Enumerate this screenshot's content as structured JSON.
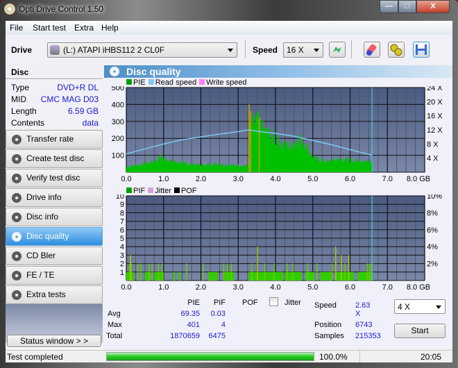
{
  "window": {
    "title": "Opti Drive Control 1.50"
  },
  "menu": [
    "File",
    "Start test",
    "Extra",
    "Help"
  ],
  "toolbar": {
    "drive_label": "Drive",
    "drive_value": "(L:)  ATAPI iHBS112   2 CL0F",
    "speed_label": "Speed",
    "speed_value": "16 X",
    "icons": [
      "refresh-icon",
      "eraser-icon",
      "settings-icon",
      "save-icon"
    ]
  },
  "disc": {
    "header": "Disc",
    "rows": [
      {
        "label": "Type",
        "value": "DVD+R DL"
      },
      {
        "label": "MID",
        "value": "CMC MAG D03"
      },
      {
        "label": "Length",
        "value": "6.59 GB"
      },
      {
        "label": "Contents",
        "value": "data"
      }
    ]
  },
  "nav": [
    {
      "label": "Transfer rate",
      "active": false
    },
    {
      "label": "Create test disc",
      "active": false
    },
    {
      "label": "Verify test disc",
      "active": false
    },
    {
      "label": "Drive info",
      "active": false
    },
    {
      "label": "Disc info",
      "active": false
    },
    {
      "label": "Disc quality",
      "active": true
    },
    {
      "label": "CD Bler",
      "active": false
    },
    {
      "label": "FE / TE",
      "active": false
    },
    {
      "label": "Extra tests",
      "active": false
    }
  ],
  "status_window_label": "Status window > >",
  "panel": {
    "title": "Disc quality"
  },
  "colors": {
    "pie": "#00c000",
    "pif": "#33cc00",
    "read_speed": "#7fc8f0",
    "write_speed": "#ff80ff",
    "jitter": "#d8a0d8",
    "pof": "#000000",
    "spike": "#c8a000",
    "plot_bg_top": "#4a5a80",
    "plot_bg_bottom": "#7a88aa",
    "end_marker": "#40c8e0"
  },
  "chart_data": [
    {
      "type": "bar",
      "title": "PIE / Read speed",
      "legend": [
        "PIE",
        "Read speed",
        "Write speed"
      ],
      "legend_position": "top-left",
      "xlabel": "GB",
      "x_ticks": [
        "0.0",
        "1.0",
        "2.0",
        "3.0",
        "4.0",
        "5.0",
        "6.0",
        "7.0",
        "8.0 GB"
      ],
      "xlim": [
        0,
        8
      ],
      "ylim": [
        0,
        500
      ],
      "y_ticks": [
        "100",
        "200",
        "300",
        "400",
        "500"
      ],
      "y2_ticks": [
        "4 X",
        "8 X",
        "12 X",
        "16 X",
        "20 X",
        "24 X"
      ],
      "y2lim": [
        0,
        24
      ],
      "grid": true,
      "data_end_gb": 6.59,
      "pie_profile": {
        "x": [
          0.0,
          0.2,
          0.4,
          0.6,
          0.8,
          0.9,
          1.0,
          1.2,
          1.4,
          1.6,
          1.8,
          2.0,
          2.2,
          2.4,
          2.6,
          2.8,
          3.0,
          3.2,
          3.28,
          3.3,
          3.4,
          3.5,
          3.6,
          3.8,
          4.0,
          4.2,
          4.4,
          4.6,
          4.8,
          5.0,
          5.2,
          5.4,
          5.6,
          5.8,
          6.0,
          6.2,
          6.4,
          6.59
        ],
        "values": [
          30,
          40,
          45,
          55,
          70,
          90,
          80,
          65,
          55,
          50,
          45,
          40,
          45,
          50,
          45,
          40,
          40,
          38,
          35,
          290,
          280,
          300,
          260,
          220,
          190,
          160,
          150,
          200,
          160,
          80,
          70,
          60,
          75,
          70,
          70,
          65,
          65,
          70
        ]
      },
      "pie_spikes": [
        {
          "x": 3.28,
          "value": 401
        },
        {
          "x": 3.32,
          "value": 360
        },
        {
          "x": 3.55,
          "value": 325
        }
      ],
      "read_speed": {
        "x": [
          0.0,
          0.5,
          1.0,
          1.5,
          2.0,
          2.5,
          3.0,
          3.3,
          3.5,
          4.0,
          4.5,
          5.0,
          5.5,
          6.0,
          6.59
        ],
        "values": [
          5.2,
          6.6,
          8.0,
          9.2,
          10.0,
          10.8,
          11.5,
          12.0,
          11.6,
          11.0,
          10.2,
          9.0,
          7.8,
          6.4,
          4.8
        ]
      }
    },
    {
      "type": "bar",
      "title": "PIF / Jitter",
      "legend": [
        "PIF",
        "Jitter",
        "POF"
      ],
      "legend_position": "top-left",
      "xlabel": "GB",
      "x_ticks": [
        "0.0",
        "1.0",
        "2.0",
        "3.0",
        "4.0",
        "5.0",
        "6.0",
        "7.0",
        "8.0 GB"
      ],
      "xlim": [
        0,
        8
      ],
      "ylim": [
        0,
        10
      ],
      "y_ticks": [
        "1",
        "2",
        "3",
        "4",
        "5",
        "6",
        "7",
        "8",
        "9",
        "10"
      ],
      "y2_ticks": [
        "2%",
        "4%",
        "6%",
        "8%",
        "10%"
      ],
      "y2lim": [
        0,
        10
      ],
      "grid": true,
      "data_end_gb": 6.59,
      "pif_spikes": [
        {
          "x": 0.08,
          "value": 2
        },
        {
          "x": 0.1,
          "value": 3
        },
        {
          "x": 0.12,
          "value": 2
        },
        {
          "x": 0.3,
          "value": 2
        },
        {
          "x": 0.38,
          "value": 2
        },
        {
          "x": 0.6,
          "value": 2
        },
        {
          "x": 0.68,
          "value": 2
        },
        {
          "x": 0.85,
          "value": 2
        },
        {
          "x": 0.95,
          "value": 2
        },
        {
          "x": 1.6,
          "value": 2
        },
        {
          "x": 2.05,
          "value": 2
        },
        {
          "x": 2.6,
          "value": 2
        },
        {
          "x": 2.7,
          "value": 2
        },
        {
          "x": 2.8,
          "value": 2
        },
        {
          "x": 3.35,
          "value": 2
        },
        {
          "x": 3.5,
          "value": 4
        },
        {
          "x": 3.7,
          "value": 2
        },
        {
          "x": 3.95,
          "value": 2
        },
        {
          "x": 4.3,
          "value": 2
        },
        {
          "x": 4.45,
          "value": 2
        },
        {
          "x": 4.85,
          "value": 2
        },
        {
          "x": 5.1,
          "value": 2
        },
        {
          "x": 5.5,
          "value": 2
        },
        {
          "x": 5.6,
          "value": 4
        },
        {
          "x": 5.75,
          "value": 3
        },
        {
          "x": 5.85,
          "value": 2
        },
        {
          "x": 5.95,
          "value": 3
        },
        {
          "x": 6.45,
          "value": 2
        },
        {
          "x": 6.5,
          "value": 2
        },
        {
          "x": 6.55,
          "value": 2
        }
      ],
      "pif_baseline_segments": [
        [
          0.0,
          0.2
        ],
        [
          0.5,
          0.65
        ],
        [
          0.75,
          1.0
        ],
        [
          1.25,
          1.3
        ],
        [
          1.4,
          1.45
        ],
        [
          2.2,
          2.45
        ],
        [
          2.6,
          2.9
        ],
        [
          3.28,
          4.2
        ],
        [
          4.25,
          4.7
        ],
        [
          4.8,
          5.05
        ],
        [
          5.2,
          5.5
        ],
        [
          5.6,
          6.1
        ],
        [
          6.2,
          6.59
        ]
      ]
    }
  ],
  "stats": {
    "headers": [
      "PIE",
      "PIF",
      "POF"
    ],
    "jitter_label": "Jitter",
    "jitter_checked": false,
    "rows": [
      {
        "label": "Avg",
        "pie": "69.35",
        "pif": "0.03"
      },
      {
        "label": "Max",
        "pie": "401",
        "pif": "4"
      },
      {
        "label": "Total",
        "pie": "1870659",
        "pif": "6475"
      }
    ],
    "speed_label": "Speed",
    "speed_value": "2.63 X",
    "speed_select": "4 X",
    "position_label": "Position",
    "position_value": "6743",
    "samples_label": "Samples",
    "samples_value": "215353",
    "start_label": "Start"
  },
  "statusbar": {
    "text": "Test completed",
    "progress_percent": 100.0,
    "progress_text": "100.0%",
    "time": "20:05"
  }
}
